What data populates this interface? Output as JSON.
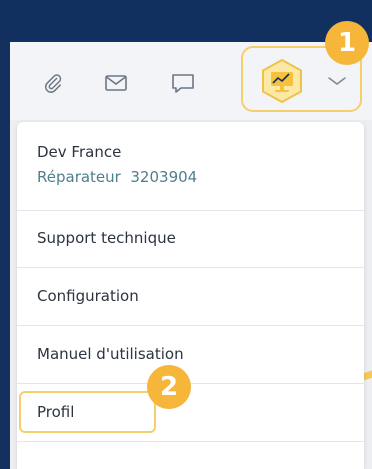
{
  "toolbar": {
    "icons": [
      "paperclip-icon",
      "mail-icon",
      "chat-icon"
    ],
    "avatar_icon": "monitor-chart-icon",
    "dropdown_icon": "chevron-down-icon"
  },
  "badges": {
    "step1": "1",
    "step2": "2"
  },
  "user": {
    "name": "Dev France",
    "role": "Réparateur",
    "id": "3203904"
  },
  "menu": {
    "items": [
      {
        "label": "Support technique"
      },
      {
        "label": "Configuration"
      },
      {
        "label": "Manuel d'utilisation"
      },
      {
        "label": "Profil"
      }
    ]
  },
  "colors": {
    "navy": "#13305f",
    "highlight": "#f4cf6b",
    "badge": "#f5b63a",
    "role_text": "#4f7f8c"
  }
}
